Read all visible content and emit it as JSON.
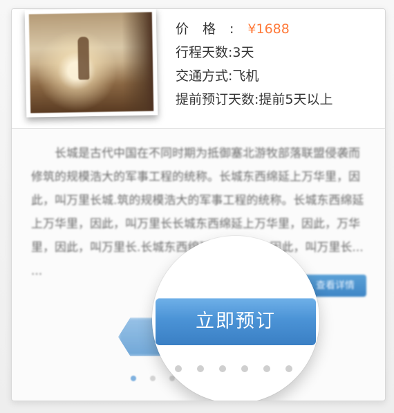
{
  "trip": {
    "price_label": "价格:",
    "price_value": "¥1688",
    "duration": "行程天数:3天",
    "transport": "交通方式:飞机",
    "advance_booking": "提前预订天数:提前5天以上"
  },
  "description": {
    "text": "长城是古代中国在不同时期为抵御塞北游牧部落联盟侵袭而修筑的规模浩大的军事工程的统称。长城东西绵延上万华里，因此，叫万里长城.筑的规模浩大的军事工程的统称。长城东西绵延上万华里，因此，叫万里长长城东西绵延上万华里，因此，万华里，因此，叫万里长.长城东西绵延上万华里，因此，叫万里长... ..."
  },
  "buttons": {
    "detail": "查看详情",
    "book": "立即预订"
  },
  "pager": {
    "active_index": 0
  },
  "colors": {
    "price": "#ff7a3a",
    "primary_blue": "#4b93d6"
  }
}
